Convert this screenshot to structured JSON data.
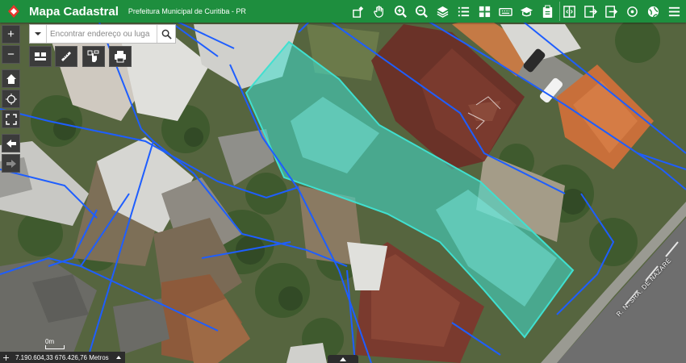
{
  "header": {
    "title": "Mapa Cadastral",
    "subtitle": "Prefeitura Municipal de Curitiba - PR"
  },
  "toolbar": {
    "tools": [
      "pin-area-icon",
      "pan-hand-icon",
      "zoom-in-icon",
      "zoom-out-icon",
      "layers-icon",
      "list-icon",
      "grid-icon",
      "keyboard-icon",
      "mortarboard-icon",
      "clipboard-icon",
      "split-view-icon",
      "export-icon",
      "exit-icon",
      "target-icon",
      "globe-icon",
      "menu-icon"
    ]
  },
  "search": {
    "placeholder": "Encontrar endereço ou luga"
  },
  "status": {
    "coordinates": "7.190.604,33 676.426,76 Metros",
    "scale_label": "0m"
  },
  "map": {
    "street_label": "R. N. SRA. DE NAZARÉ",
    "highlight_color": "#40e0d0",
    "parcel_line_color": "#1e5eff"
  },
  "colors": {
    "header": "#1e8e3e",
    "button": "#3b3b3b"
  }
}
